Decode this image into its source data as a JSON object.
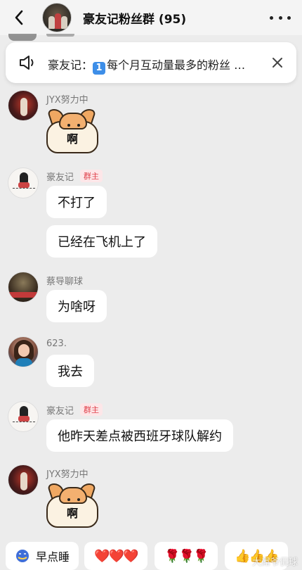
{
  "header": {
    "title": "豪友记粉丝群 (95)",
    "back_icon": "chevron-left-icon",
    "more_icon": "more-dots-icon"
  },
  "announcement": {
    "text_prefix": "豪友记：",
    "keycap": "1",
    "text_body": "每个月互动量最多的粉丝 …",
    "speaker_icon": "speaker-icon",
    "close_icon": "close-icon"
  },
  "messages": [
    {
      "sender": "JYX努力中",
      "type": "sticker",
      "sticker_text": "啊"
    },
    {
      "sender": "豪友记",
      "badge": "群主",
      "type": "text",
      "texts": [
        "不打了",
        "已经在飞机上了"
      ]
    },
    {
      "sender": "蔡导聊球",
      "type": "text",
      "texts": [
        "为啥呀"
      ]
    },
    {
      "sender": "623.",
      "type": "text",
      "texts": [
        "我去"
      ]
    },
    {
      "sender": "豪友记",
      "badge": "群主",
      "type": "text",
      "texts": [
        "他昨天差点被西班牙球队解约"
      ]
    },
    {
      "sender": "JYX努力中",
      "type": "sticker",
      "sticker_text": "啊"
    }
  ],
  "quick_replies": [
    {
      "label": "早点睡",
      "icon": "sleep-emoji-icon"
    },
    {
      "label": "❤️❤️❤️",
      "icon": "hearts-icon"
    },
    {
      "label": "🌹🌹🌹",
      "icon": "roses-icon"
    },
    {
      "label": "👍👍👍",
      "icon": "thumbs-up-icon"
    }
  ],
  "watermark": "大屌爷侃球",
  "colors": {
    "background": "#ececec",
    "bubble": "#ffffff",
    "owner_badge_text": "#e0404a",
    "owner_badge_bg": "#fde6e8",
    "keycap": "#3d8ee8"
  }
}
